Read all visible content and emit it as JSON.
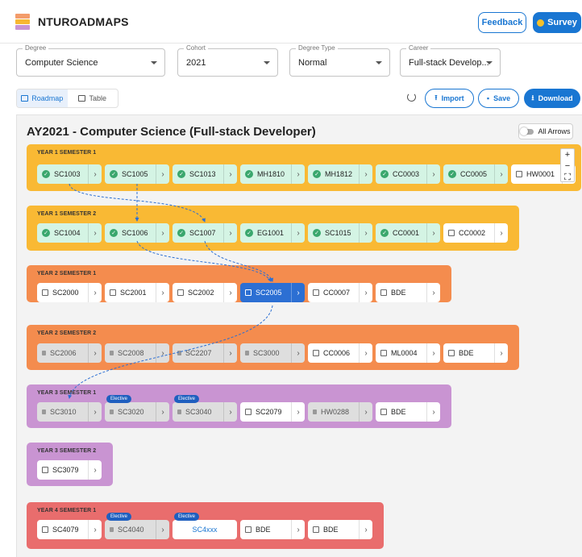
{
  "header": {
    "app_title": "NTUROADMAPS",
    "feedback_label": "Feedback",
    "survey_label": "Survey",
    "logo_colors": [
      "#f39c6b",
      "#f7b731",
      "#c994d2"
    ]
  },
  "filters": {
    "degree": {
      "label": "Degree",
      "value": "Computer Science"
    },
    "cohort": {
      "label": "Cohort",
      "value": "2021"
    },
    "degree_type": {
      "label": "Degree Type",
      "value": "Normal"
    },
    "career": {
      "label": "Career",
      "value": "Full-stack Develop..."
    }
  },
  "toolbar": {
    "tab_roadmap": "Roadmap",
    "tab_table": "Table",
    "active_tab": "Roadmap",
    "import_label": "Import",
    "save_label": "Save",
    "download_label": "Download"
  },
  "plan": {
    "title": "AY2021 - Computer Science (Full-stack Developer)",
    "all_arrows_label": "All Arrows",
    "all_arrows_on": false,
    "zoom_in": "+",
    "zoom_out": "−",
    "fit_view": "⛶"
  },
  "colors": {
    "year1": "#f9b934",
    "year2": "#f48c4e",
    "year3": "#c994d2",
    "year4": "#e96d6d",
    "completed": "#d4f4e4",
    "selected": "#2c6fd3",
    "accent": "#1976d2"
  },
  "semesters": [
    {
      "label": "YEAR 1 SEMESTER 1",
      "color": "year1",
      "courses": [
        {
          "code": "SC1003",
          "status": "done"
        },
        {
          "code": "SC1005",
          "status": "done"
        },
        {
          "code": "SC1013",
          "status": "done"
        },
        {
          "code": "MH1810",
          "status": "done"
        },
        {
          "code": "MH1812",
          "status": "done"
        },
        {
          "code": "CC0003",
          "status": "done"
        },
        {
          "code": "CC0005",
          "status": "done"
        },
        {
          "code": "HW0001",
          "status": "todo"
        }
      ]
    },
    {
      "label": "YEAR 1 SEMESTER 2",
      "color": "year1",
      "courses": [
        {
          "code": "SC1004",
          "status": "done"
        },
        {
          "code": "SC1006",
          "status": "done"
        },
        {
          "code": "SC1007",
          "status": "done"
        },
        {
          "code": "EG1001",
          "status": "done"
        },
        {
          "code": "SC1015",
          "status": "done"
        },
        {
          "code": "CC0001",
          "status": "done"
        },
        {
          "code": "CC0002",
          "status": "todo"
        }
      ]
    },
    {
      "label": "YEAR 2 SEMESTER 1",
      "color": "year2",
      "courses": [
        {
          "code": "SC2000",
          "status": "todo"
        },
        {
          "code": "SC2001",
          "status": "todo"
        },
        {
          "code": "SC2002",
          "status": "todo"
        },
        {
          "code": "SC2005",
          "status": "selected"
        },
        {
          "code": "CC0007",
          "status": "todo"
        },
        {
          "code": "BDE",
          "status": "todo"
        }
      ]
    },
    {
      "label": "YEAR 2 SEMESTER 2",
      "color": "year2",
      "courses": [
        {
          "code": "SC2006",
          "status": "locked"
        },
        {
          "code": "SC2008",
          "status": "locked"
        },
        {
          "code": "SC2207",
          "status": "locked"
        },
        {
          "code": "SC3000",
          "status": "locked"
        },
        {
          "code": "CC0006",
          "status": "todo"
        },
        {
          "code": "ML0004",
          "status": "todo"
        },
        {
          "code": "BDE",
          "status": "todo"
        }
      ]
    },
    {
      "label": "YEAR 3 SEMESTER 1",
      "color": "year3",
      "courses": [
        {
          "code": "SC3010",
          "status": "locked"
        },
        {
          "code": "SC3020",
          "status": "locked",
          "tag": "Elective"
        },
        {
          "code": "SC3040",
          "status": "locked",
          "tag": "Elective"
        },
        {
          "code": "SC2079",
          "status": "todo"
        },
        {
          "code": "HW0288",
          "status": "locked"
        },
        {
          "code": "BDE",
          "status": "todo"
        }
      ]
    },
    {
      "label": "YEAR 3 SEMESTER 2",
      "color": "year3",
      "courses": [
        {
          "code": "SC3079",
          "status": "todo"
        }
      ]
    },
    {
      "label": "YEAR 4 SEMESTER 1",
      "color": "year4",
      "courses": [
        {
          "code": "SC4079",
          "status": "todo"
        },
        {
          "code": "SC4040",
          "status": "locked",
          "tag": "Elective"
        },
        {
          "code": "SC4xxx",
          "status": "link",
          "tag": "Elective"
        },
        {
          "code": "BDE",
          "status": "todo"
        },
        {
          "code": "BDE",
          "status": "todo"
        }
      ]
    }
  ]
}
